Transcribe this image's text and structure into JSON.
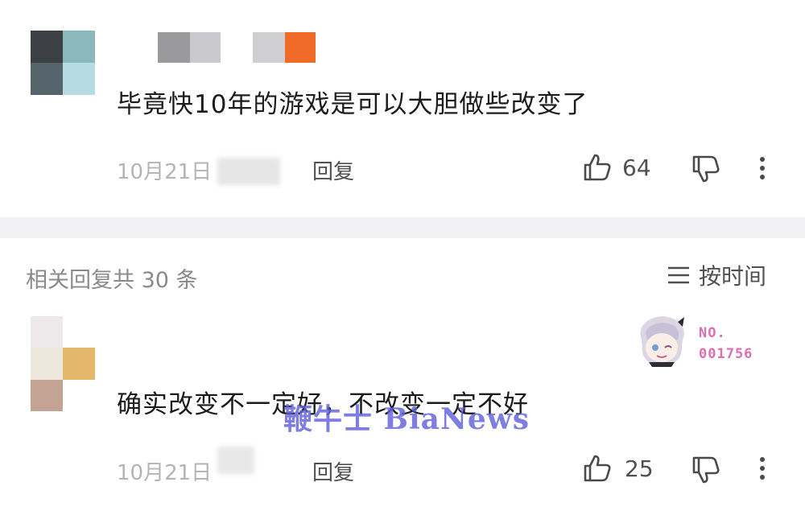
{
  "comments": [
    {
      "text": "毕竟快10年的游戏是可以大胆做些改变了",
      "date": "10月21日",
      "reply_label": "回复",
      "likes": "64"
    }
  ],
  "replies_header": {
    "title": "相关回复共 30 条",
    "sort_label": "按时间"
  },
  "replies": [
    {
      "text": "确实改变不一定好，不改变一定不好",
      "date": "10月21日",
      "reply_label": "回复",
      "likes": "25",
      "badge_line1": "NO.",
      "badge_line2": "001756"
    }
  ],
  "watermark": "鞭牛士 BiaNews",
  "icons": {
    "like": "thumbs-up-icon",
    "dislike": "thumbs-down-icon",
    "more": "more-vertical-icon",
    "sort": "sort-lines-icon"
  },
  "colors": {
    "badge": "#de6fb0",
    "watermark": "#6060dc",
    "divider": "#f2f2f4"
  }
}
